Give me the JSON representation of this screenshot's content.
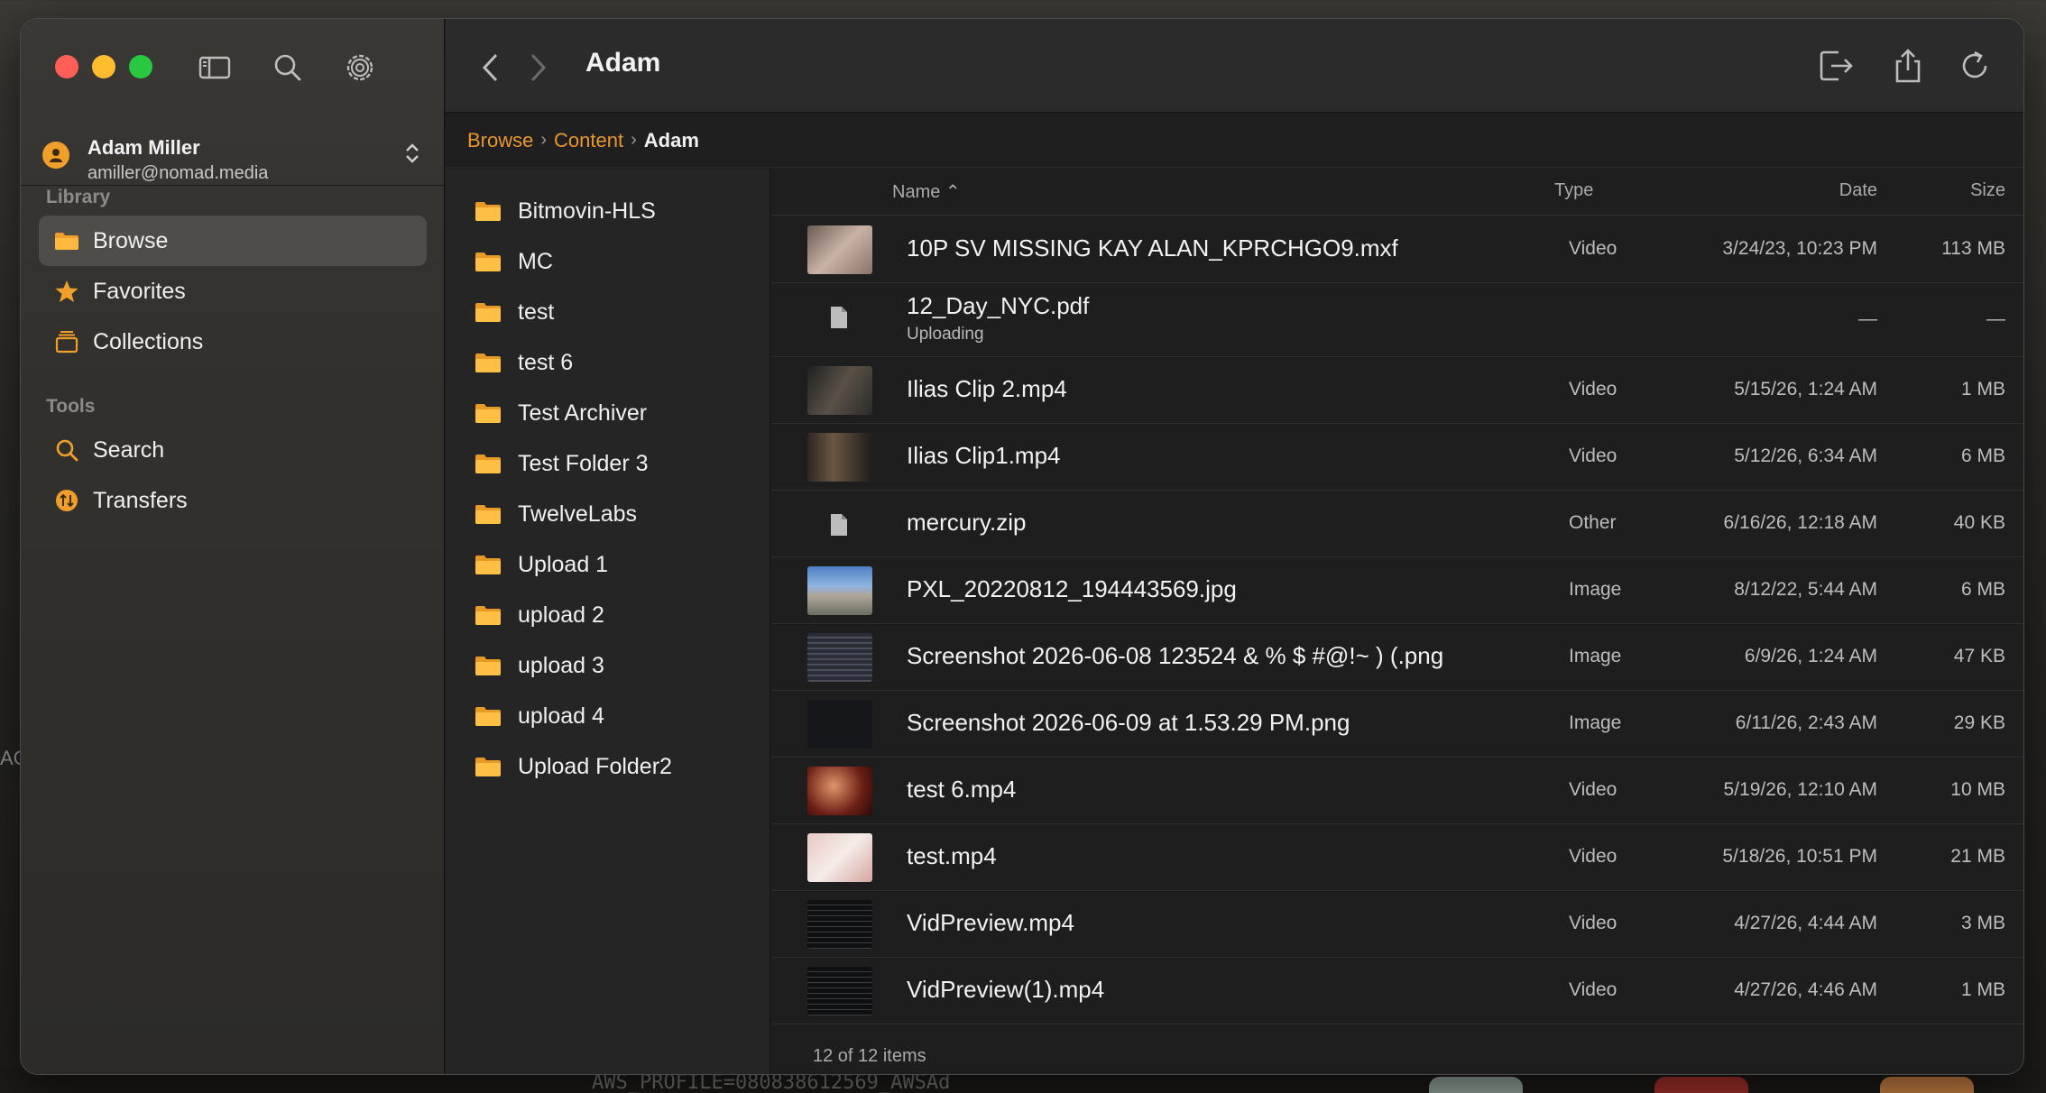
{
  "window": {
    "title": "Adam"
  },
  "account": {
    "name": "Adam Miller",
    "email": "amiller@nomad.media"
  },
  "sidebar": {
    "library_label": "Library",
    "tools_label": "Tools",
    "library_items": [
      {
        "label": "Browse",
        "icon": "folder-icon",
        "selected": true
      },
      {
        "label": "Favorites",
        "icon": "star-icon",
        "selected": false
      },
      {
        "label": "Collections",
        "icon": "collections-icon",
        "selected": false
      }
    ],
    "tool_items": [
      {
        "label": "Search",
        "icon": "search-icon"
      },
      {
        "label": "Transfers",
        "icon": "transfers-icon"
      }
    ]
  },
  "breadcrumb": {
    "items": [
      "Browse",
      "Content"
    ],
    "current": "Adam"
  },
  "folders": [
    "Bitmovin-HLS",
    "MC",
    "test",
    "test 6",
    "Test Archiver",
    "Test Folder 3",
    "TwelveLabs",
    "Upload 1",
    "upload 2",
    "upload 3",
    "upload 4",
    "Upload Folder2"
  ],
  "table": {
    "columns": {
      "name": "Name",
      "type": "Type",
      "date": "Date",
      "size": "Size"
    },
    "rows": [
      {
        "name": "10P SV MISSING KAY ALAN_KPRCHGO9.mxf",
        "sub": "",
        "type": "Video",
        "date": "3/24/23, 10:23 PM",
        "size": "113 MB",
        "thumb": "portrait"
      },
      {
        "name": "12_Day_NYC.pdf",
        "sub": "Uploading",
        "type": "",
        "date": "—",
        "size": "—",
        "thumb": "doc"
      },
      {
        "name": "Ilias Clip 2.mp4",
        "sub": "",
        "type": "Video",
        "date": "5/15/26, 1:24 AM",
        "size": "1 MB",
        "thumb": "dark"
      },
      {
        "name": "Ilias Clip1.mp4",
        "sub": "",
        "type": "Video",
        "date": "5/12/26, 6:34 AM",
        "size": "6 MB",
        "thumb": "dark2"
      },
      {
        "name": "mercury.zip",
        "sub": "",
        "type": "Other",
        "date": "6/16/26, 12:18 AM",
        "size": "40 KB",
        "thumb": "doc"
      },
      {
        "name": "PXL_20220812_194443569.jpg",
        "sub": "",
        "type": "Image",
        "date": "8/12/22, 5:44 AM",
        "size": "6 MB",
        "thumb": "landscape"
      },
      {
        "name": "Screenshot 2026-06-08 123524 & % $ #@!~   ) (.png",
        "sub": "",
        "type": "Image",
        "date": "6/9/26, 1:24 AM",
        "size": "47 KB",
        "thumb": "screen"
      },
      {
        "name": "Screenshot 2026-06-09 at 1.53.29 PM.png",
        "sub": "",
        "type": "Image",
        "date": "6/11/26, 2:43 AM",
        "size": "29 KB",
        "thumb": "screen2"
      },
      {
        "name": "test 6.mp4",
        "sub": "",
        "type": "Video",
        "date": "5/19/26, 12:10 AM",
        "size": "10 MB",
        "thumb": "red"
      },
      {
        "name": "test.mp4",
        "sub": "",
        "type": "Video",
        "date": "5/18/26, 10:51 PM",
        "size": "21 MB",
        "thumb": "pink"
      },
      {
        "name": "VidPreview.mp4",
        "sub": "",
        "type": "Video",
        "date": "4/27/26, 4:44 AM",
        "size": "3 MB",
        "thumb": "term"
      },
      {
        "name": "VidPreview(1).mp4",
        "sub": "",
        "type": "Video",
        "date": "4/27/26, 4:46 AM",
        "size": "1 MB",
        "thumb": "term"
      }
    ]
  },
  "footer": {
    "count_text": "12 of 12 items"
  },
  "background": {
    "terminal_text": "AWS_PROFILE=080838612569_AWSAd",
    "left_text": "AC"
  },
  "colors": {
    "accent": "#e9962f",
    "selected_bg": "#4f4d4a"
  }
}
